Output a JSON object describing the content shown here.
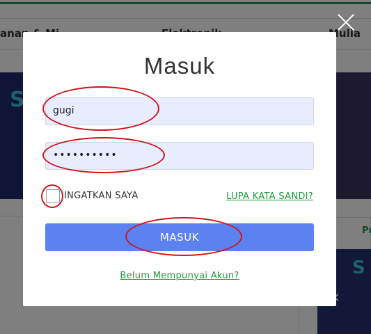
{
  "background": {
    "nav_items": [
      "anan & Mi",
      "Elektronik",
      "Mulia"
    ],
    "right_tab": "Pr"
  },
  "modal": {
    "title": "Masuk",
    "username": {
      "value": "gugi"
    },
    "password": {
      "value": "••••••••••"
    },
    "remember_label": "INGATKAN SAYA",
    "remember_checked": false,
    "forgot_label": "LUPA KATA SANDI?",
    "submit_label": "MASUK",
    "register_label": "Belum Mempunyai Akun?"
  },
  "colors": {
    "accent_button": "#5b82f0",
    "link_green": "#1a9a3a",
    "field_bg": "#e8ecfc",
    "annotation_red": "#d0141c"
  },
  "icons": {
    "close": "close-icon"
  }
}
